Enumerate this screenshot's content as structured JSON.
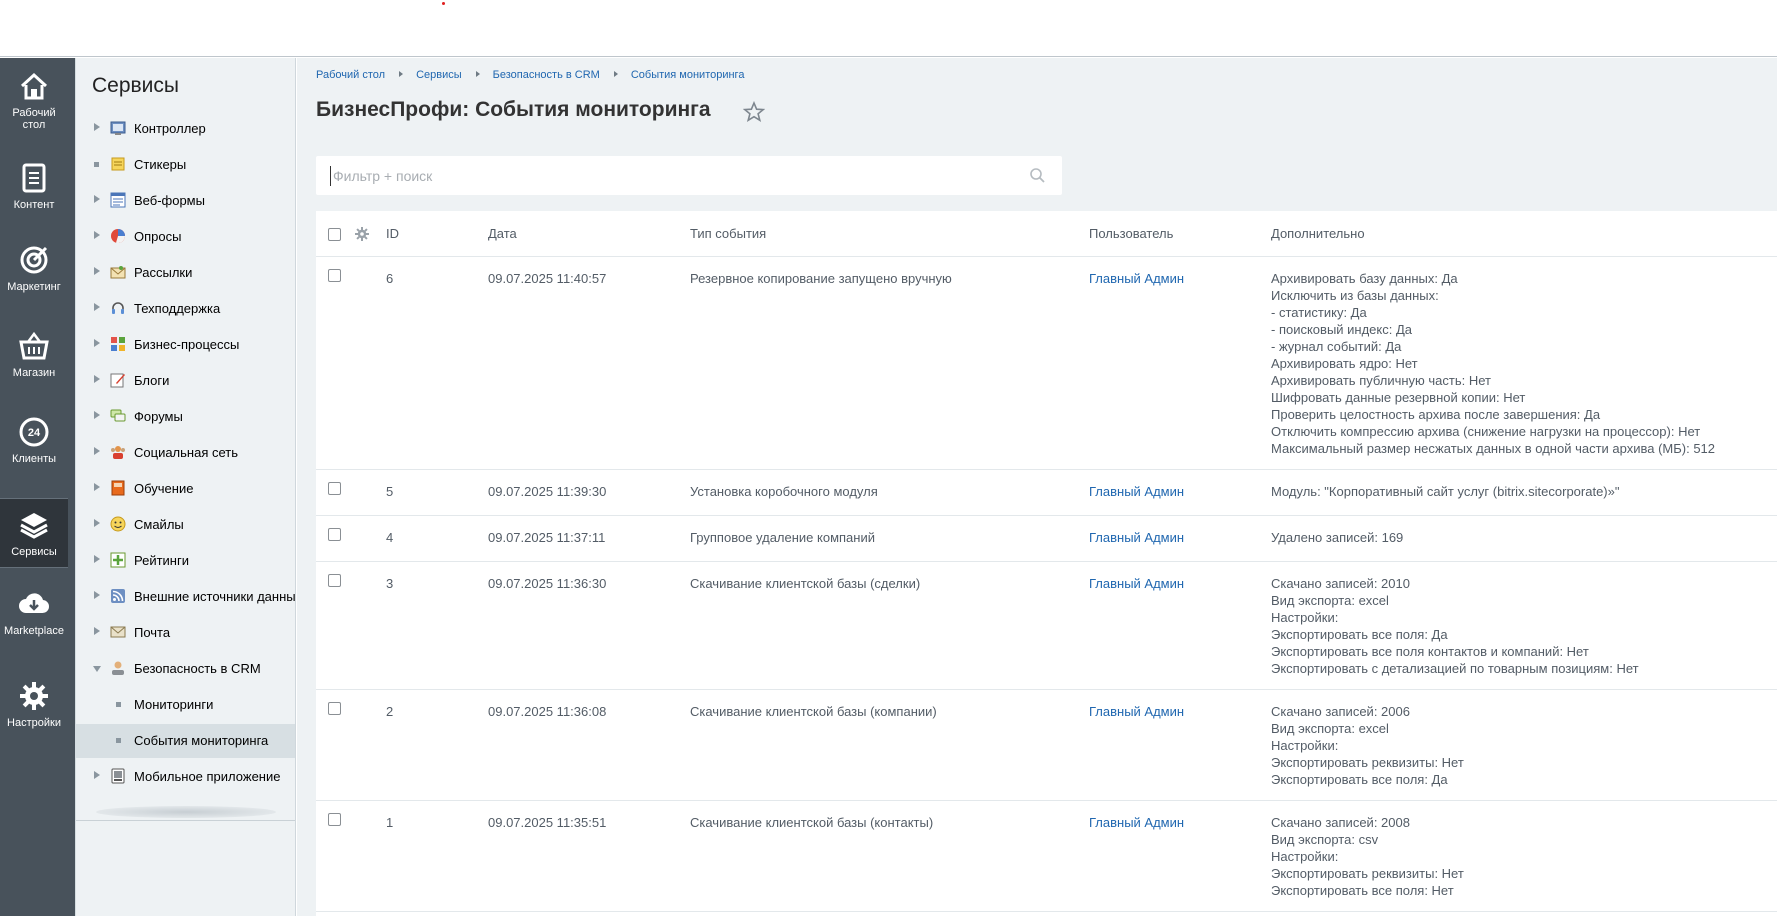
{
  "leftbar": [
    {
      "label": "Рабочий стол",
      "icon": "home-icon"
    },
    {
      "label": "Контент",
      "icon": "document-icon"
    },
    {
      "label": "Маркетинг",
      "icon": "target-icon"
    },
    {
      "label": "Магазин",
      "icon": "basket-icon"
    },
    {
      "label": "Клиенты",
      "icon": "crm-24-icon",
      "badge": "24"
    },
    {
      "label": "Сервисы",
      "icon": "layers-icon",
      "active": true
    },
    {
      "label": "Marketplace",
      "icon": "cloud-download-icon"
    },
    {
      "label": "Настройки",
      "icon": "gear-icon"
    }
  ],
  "sidebar": {
    "title": "Сервисы",
    "items": [
      {
        "label": "Контроллер",
        "marker": "arrow",
        "icon": "controller-icon"
      },
      {
        "label": "Стикеры",
        "marker": "bullet",
        "icon": "sticker-icon"
      },
      {
        "label": "Веб-формы",
        "marker": "arrow",
        "icon": "webform-icon"
      },
      {
        "label": "Опросы",
        "marker": "arrow",
        "icon": "poll-icon"
      },
      {
        "label": "Рассылки",
        "marker": "arrow",
        "icon": "mail-icon"
      },
      {
        "label": "Техподдержка",
        "marker": "arrow",
        "icon": "headset-icon"
      },
      {
        "label": "Бизнес-процессы",
        "marker": "arrow",
        "icon": "process-icon"
      },
      {
        "label": "Блоги",
        "marker": "arrow",
        "icon": "blog-icon"
      },
      {
        "label": "Форумы",
        "marker": "arrow",
        "icon": "forum-icon"
      },
      {
        "label": "Социальная сеть",
        "marker": "arrow",
        "icon": "social-icon"
      },
      {
        "label": "Обучение",
        "marker": "arrow",
        "icon": "learning-icon"
      },
      {
        "label": "Смайлы",
        "marker": "arrow",
        "icon": "smile-icon"
      },
      {
        "label": "Рейтинги",
        "marker": "arrow",
        "icon": "rating-icon"
      },
      {
        "label": "Внешние источники данных",
        "marker": "arrow",
        "icon": "rss-icon"
      },
      {
        "label": "Почта",
        "marker": "arrow",
        "icon": "post-icon"
      },
      {
        "label": "Безопасность в CRM",
        "marker": "arrow-down",
        "icon": "user-security-icon"
      },
      {
        "label": "Мониторинги",
        "marker": "bullet",
        "sub": true
      },
      {
        "label": "События мониторинга",
        "marker": "bullet",
        "sub": true,
        "selected": true
      },
      {
        "label": "Мобильное приложение",
        "marker": "arrow",
        "icon": "mobile-icon"
      }
    ]
  },
  "breadcrumb": [
    "Рабочий стол",
    "Сервисы",
    "Безопасность в CRM",
    "События мониторинга"
  ],
  "page_title": "БизнесПрофи: События мониторинга",
  "filter": {
    "placeholder": "Фильтр + поиск",
    "value": ""
  },
  "table": {
    "columns": {
      "id": "ID",
      "date": "Дата",
      "type": "Тип события",
      "user": "Пользователь",
      "extra": "Дополнительно"
    },
    "rows": [
      {
        "id": "6",
        "date": "09.07.2025 11:40:57",
        "type": "Резервное копирование запущено вручную",
        "user": "Главный Админ",
        "extra": "Архивировать базу данных: Да\nИсключить из базы данных:\n- статистику: Да\n- поисковый индекс: Да\n- журнал событий: Да\nАрхивировать ядро: Нет\nАрхивировать публичную часть: Нет\nШифровать данные резервной копии: Нет\nПроверить целостность архива после завершения: Да\nОтключить компрессию архива (снижение нагрузки на процессор): Нет\nМаксимальный размер несжатых данных в одной части архива (МБ): 512"
      },
      {
        "id": "5",
        "date": "09.07.2025 11:39:30",
        "type": "Установка коробочного модуля",
        "user": "Главный Админ",
        "extra": "Модуль: \"Корпоративный сайт услуг (bitrix.sitecorporate)»\""
      },
      {
        "id": "4",
        "date": "09.07.2025 11:37:11",
        "type": "Групповое удаление компаний",
        "user": "Главный Админ",
        "extra": "Удалено записей: 169"
      },
      {
        "id": "3",
        "date": "09.07.2025 11:36:30",
        "type": "Скачивание клиентской базы (сделки)",
        "user": "Главный Админ",
        "extra": "Скачано записей: 2010\nВид экспорта: excel\nНастройки:\nЭкспортировать все поля: Да\nЭкспортировать все поля контактов и компаний: Нет\nЭкспортировать с детализацией по товарным позициям: Нет"
      },
      {
        "id": "2",
        "date": "09.07.2025 11:36:08",
        "type": "Скачивание клиентской базы (компании)",
        "user": "Главный Админ",
        "extra": "Скачано записей: 2006\nВид экспорта: excel\nНастройки:\nЭкспортировать реквизиты: Нет\nЭкспортировать все поля: Да"
      },
      {
        "id": "1",
        "date": "09.07.2025 11:35:51",
        "type": "Скачивание клиентской базы (контакты)",
        "user": "Главный Админ",
        "extra": "Скачано записей: 2008\nВид экспорта: csv\nНастройки:\nЭкспортировать реквизиты: Нет\nЭкспортировать все поля: Нет"
      }
    ]
  },
  "colors": {
    "link": "#2067b0",
    "leftbar": "#48525b",
    "leftbar_active": "#2f353b",
    "background": "#eef2f4",
    "text": "#535c66"
  }
}
